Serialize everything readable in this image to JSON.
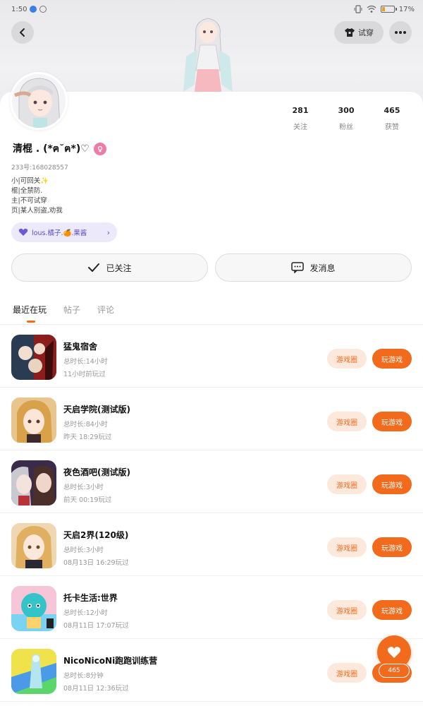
{
  "status_bar": {
    "time": "1:50",
    "battery": "17%"
  },
  "header": {
    "back_icon": "chevron-left-icon",
    "tryon_label": "试穿",
    "more_icon": "more-dots-icon"
  },
  "profile": {
    "stats": [
      {
        "num": "281",
        "label": "关注"
      },
      {
        "num": "300",
        "label": "粉丝"
      },
      {
        "num": "465",
        "label": "获赞"
      }
    ],
    "username": "清棍 . (*ฅ˘ฅ*)♡",
    "gender_icon": "female-icon",
    "uid": "233号:168028557",
    "bio": [
      "小|可回关✨",
      "棍|全禁防.",
      "主|不可试穿",
      "页|某人别盗,劝我"
    ],
    "tag_chip": "lous.橘子.🍊.果酱"
  },
  "actions": {
    "follow_label": "已关注",
    "message_label": "发消息"
  },
  "tabs": [
    {
      "label": "最近在玩",
      "active": true
    },
    {
      "label": "帖子",
      "active": false
    },
    {
      "label": "评论",
      "active": false
    }
  ],
  "games": [
    {
      "name": "猛鬼宿舍",
      "duration": "总时长:14小时",
      "last": "11小时前玩过",
      "circle": "游戏圈",
      "play": "玩游戏"
    },
    {
      "name": "天启学院(测试版)",
      "duration": "总时长:84小时",
      "last": "昨天 18:29玩过",
      "circle": "游戏圈",
      "play": "玩游戏"
    },
    {
      "name": "夜色酒吧(测试版)",
      "duration": "总时长:3小时",
      "last": "前天 00:19玩过",
      "circle": "游戏圈",
      "play": "玩游戏"
    },
    {
      "name": "天启2界(120级)",
      "duration": "总时长:3小时",
      "last": "08月13日 16:29玩过",
      "circle": "游戏圈",
      "play": "玩游戏"
    },
    {
      "name": "托卡生活:世界",
      "duration": "总时长:12小时",
      "last": "08月11日 17:07玩过",
      "circle": "游戏圈",
      "play": "玩游戏"
    },
    {
      "name": "NicoNicoNi跑跑训练营",
      "duration": "总时长:8分钟",
      "last": "08月11日 12:36玩过",
      "circle": "游戏圈",
      "play": "玩游戏"
    }
  ],
  "fab": {
    "icon": "heart-icon",
    "count": "465"
  },
  "colors": {
    "accent": "#f26b1d",
    "accent_light": "#fde9dc",
    "chip_bg": "#ece9fb",
    "chip_text": "#5b4fc6"
  }
}
